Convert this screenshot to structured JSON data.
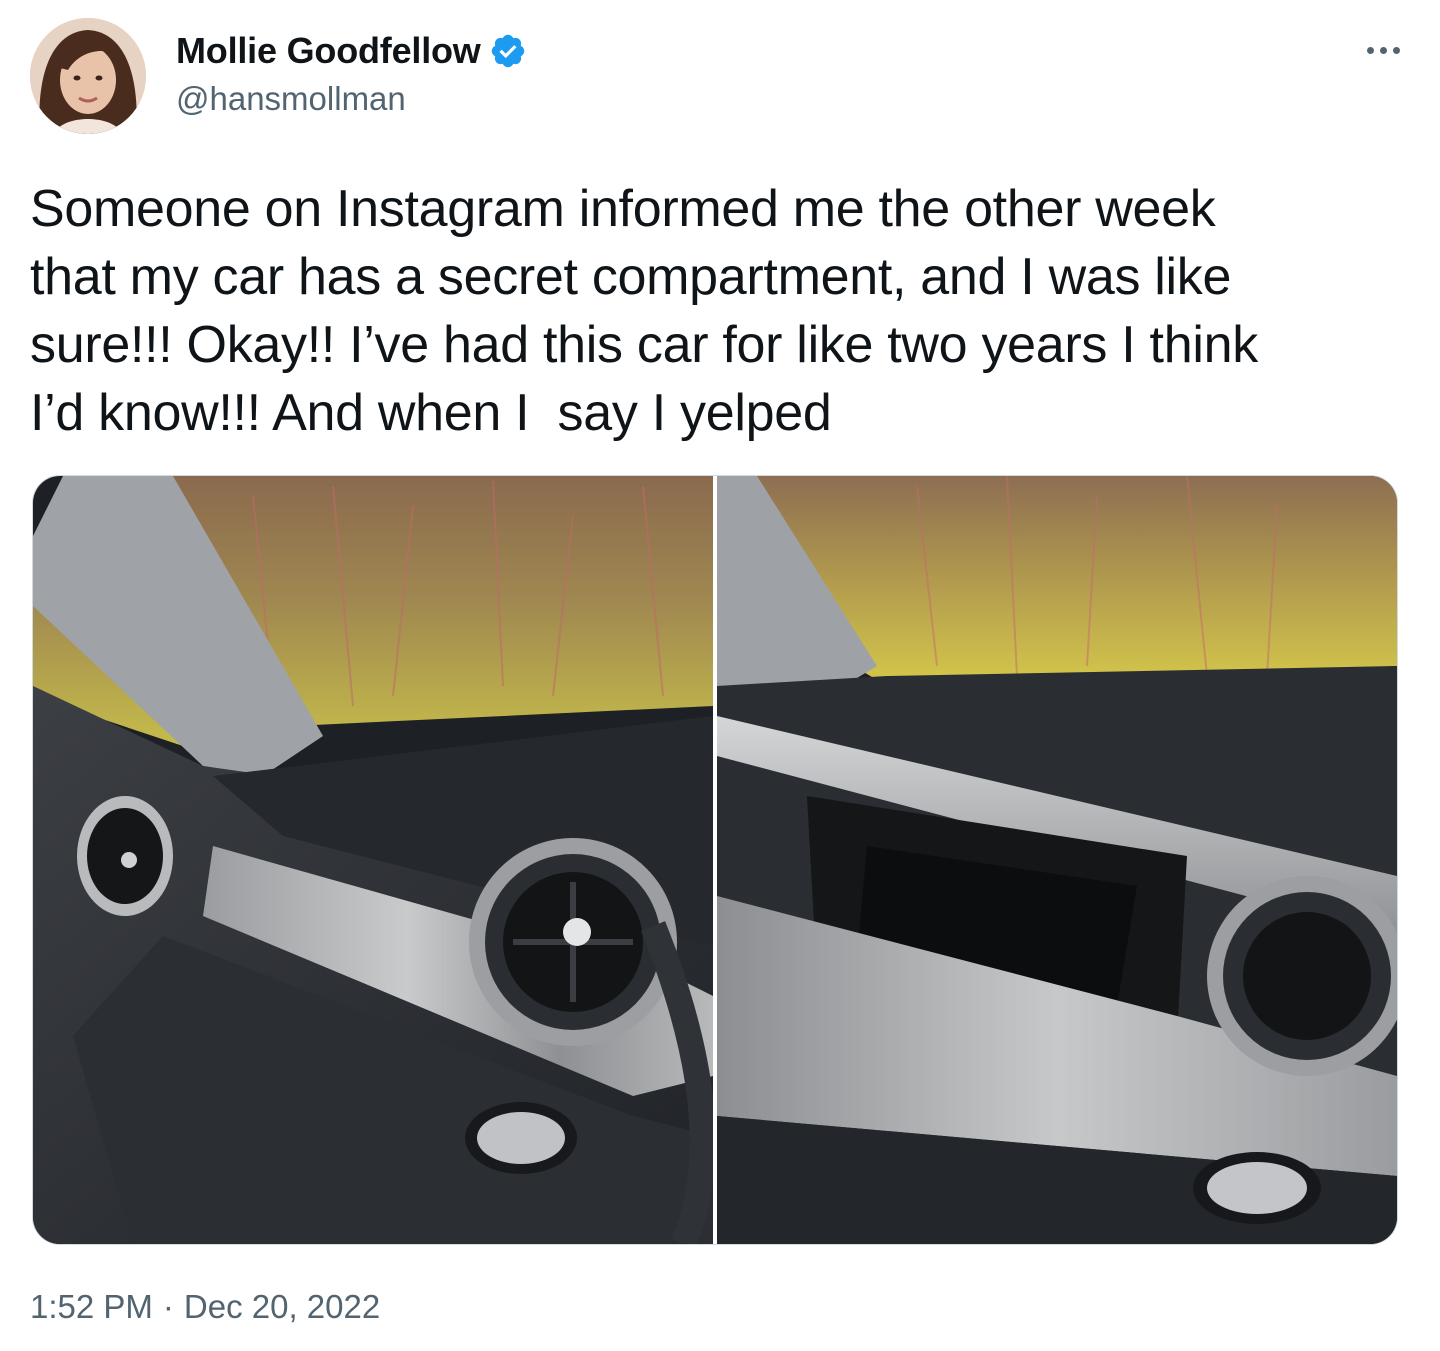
{
  "author": {
    "display_name": "Mollie Goodfellow",
    "handle": "@hansmollman",
    "verified_icon": "verified-badge-icon",
    "verified_color": "#1d9bf0"
  },
  "more_icon": "more-horizontal-icon",
  "tweet": {
    "text": "Someone on Instagram informed me the other week\nthat my car has a secret compartment, and I was like\nsure!!! Okay!! I’ve had this car for like two years I think\nI’d know!!! And when I  say I yelped"
  },
  "media": [
    {
      "name": "photo-dashboard-closed"
    },
    {
      "name": "photo-dashboard-open-compartment"
    }
  ],
  "timestamp": {
    "time": "1:52 PM",
    "separator": "·",
    "date": "Dec 20, 2022"
  },
  "colors": {
    "text": "#0f1419",
    "secondary": "#536471",
    "border": "#cfd9de"
  }
}
